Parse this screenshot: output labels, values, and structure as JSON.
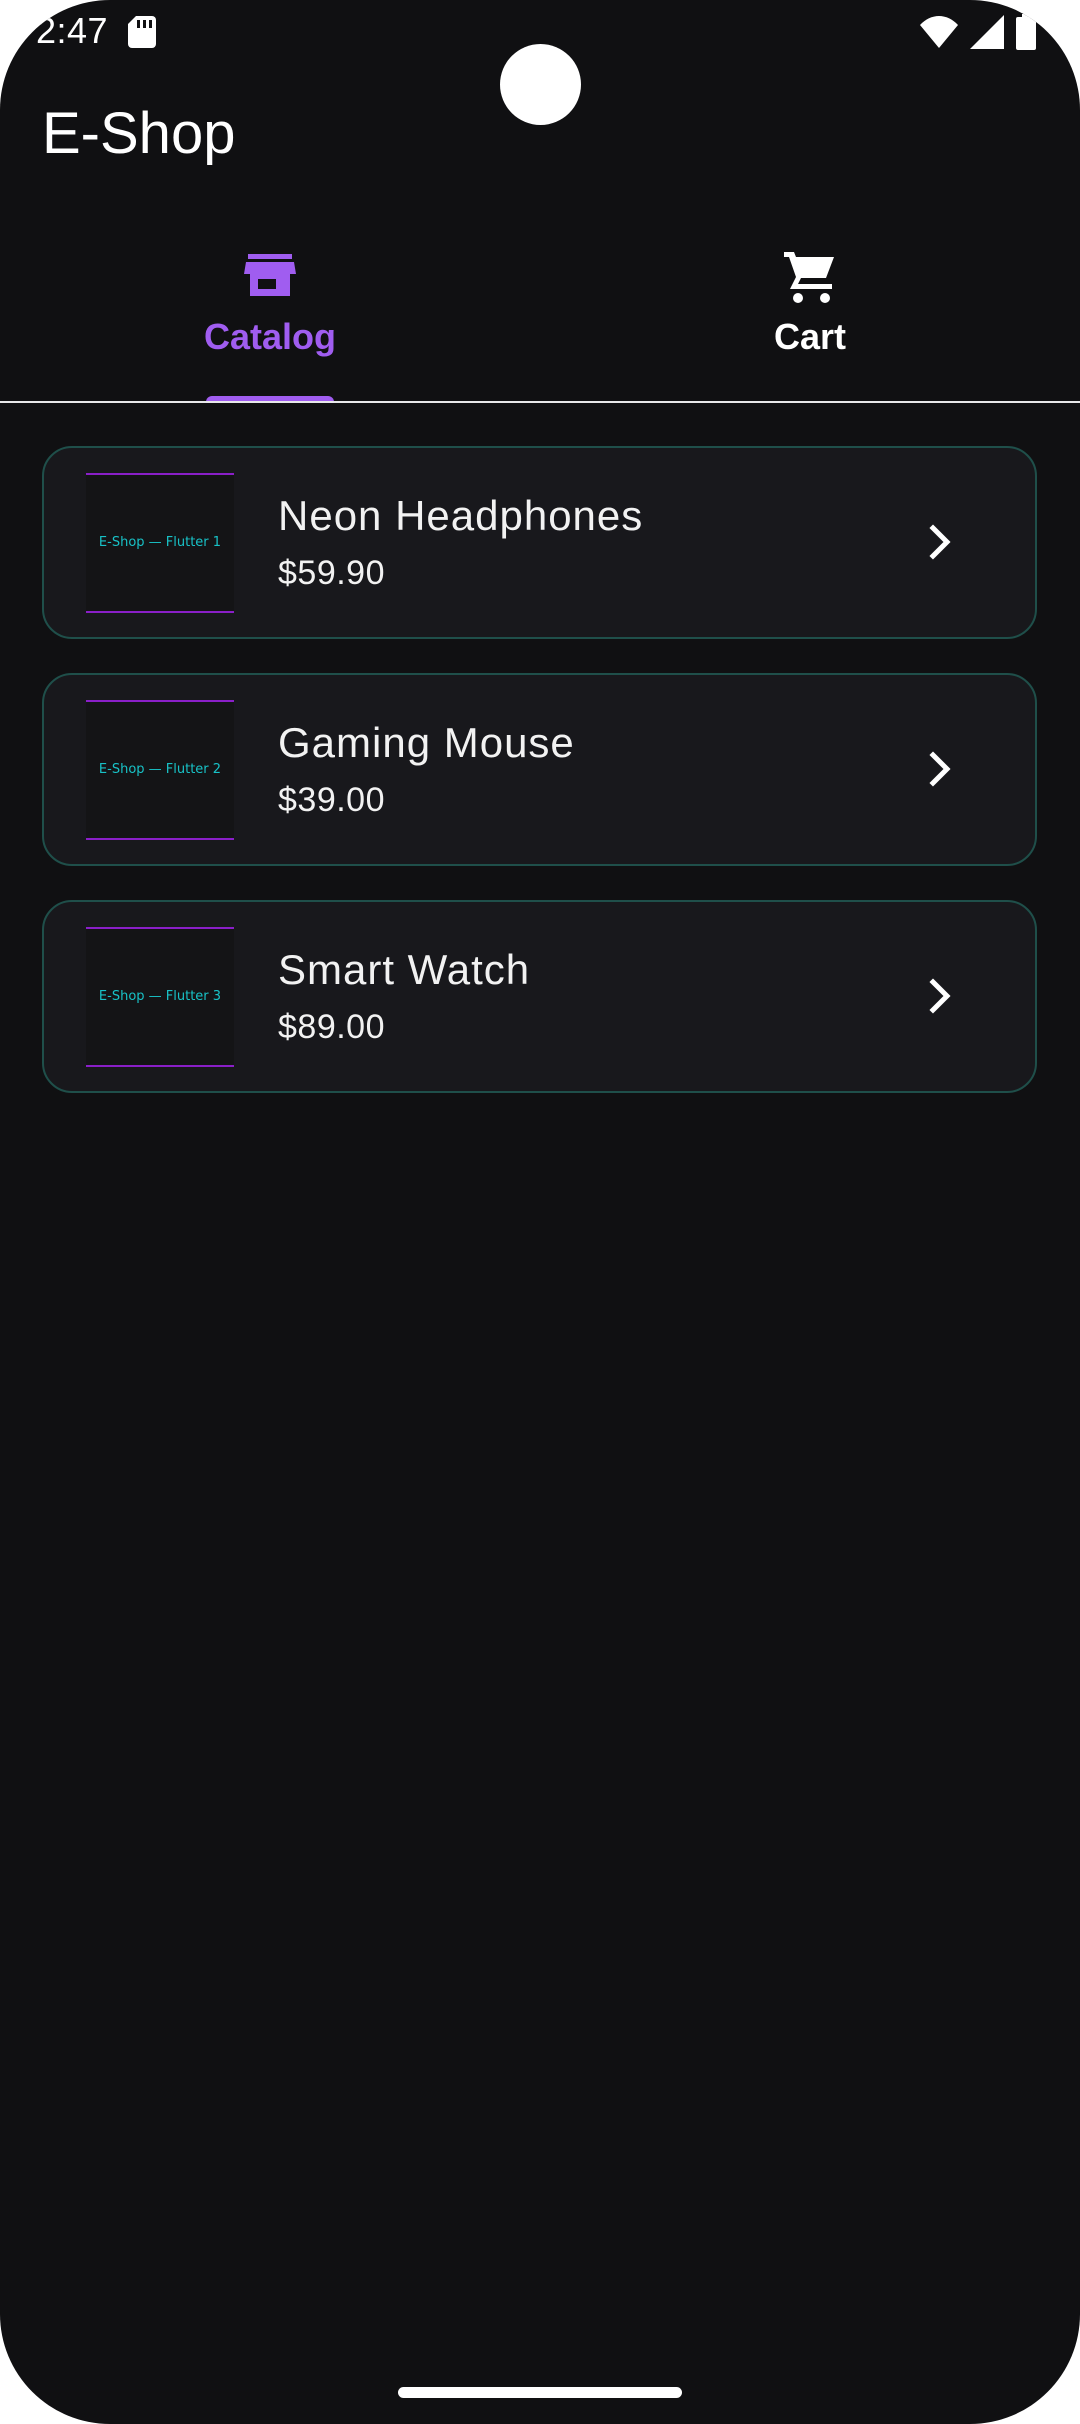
{
  "status_bar": {
    "time": "2:47",
    "icons": [
      "sd-card-icon",
      "wifi-icon",
      "signal-icon",
      "battery-icon"
    ]
  },
  "app": {
    "title": "E-Shop"
  },
  "tabs": [
    {
      "label": "Catalog",
      "icon": "store-icon",
      "selected": true
    },
    {
      "label": "Cart",
      "icon": "cart-icon",
      "selected": false
    }
  ],
  "products": [
    {
      "name": "Neon Headphones",
      "price": "$59.90",
      "thumb_text": "E-Shop — Flutter 1"
    },
    {
      "name": "Gaming Mouse",
      "price": "$39.00",
      "thumb_text": "E-Shop — Flutter 2"
    },
    {
      "name": "Smart Watch",
      "price": "$89.00",
      "thumb_text": "E-Shop — Flutter 3"
    }
  ],
  "colors": {
    "background": "#101012",
    "accent": "#a05df0",
    "card_border": "#1f4f4a",
    "thumb_text": "#18c2c7",
    "thumb_line": "#8a1fc8"
  }
}
